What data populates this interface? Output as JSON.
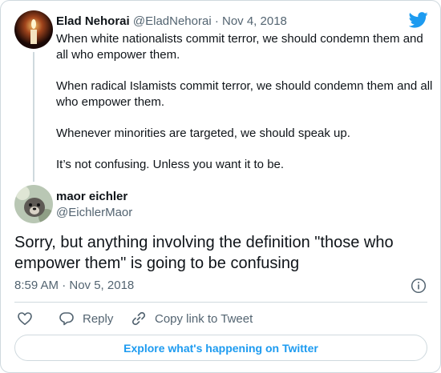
{
  "parent_tweet": {
    "display_name": "Elad Nehorai",
    "handle": "@EladNehorai",
    "separator": "·",
    "date": "Nov 4, 2018",
    "paragraphs": [
      "When white nationalists commit terror, we should condemn them and all who empower them.",
      "When radical Islamists commit terror, we should condemn them and all who empower them.",
      "Whenever minorities are targeted, we should speak up.",
      "It’s not confusing. Unless you want it to be."
    ]
  },
  "reply_tweet": {
    "display_name": "maor eichler",
    "handle": "@EichlerMaor",
    "text": "Sorry, but anything involving the definition \"those who empower them\" is going to be confusing",
    "timestamp": "8:59 AM · Nov 5, 2018"
  },
  "actions": {
    "reply_label": "Reply",
    "copy_label": "Copy link to Tweet"
  },
  "explore_button": {
    "label": "Explore what's happening on Twitter"
  },
  "icons": {
    "brand": "twitter-bird-icon",
    "info": "info-icon",
    "like": "heart-icon",
    "reply": "reply-bubble-icon",
    "copy": "link-icon"
  },
  "colors": {
    "accent": "#1d9bf0",
    "text": "#0f1419",
    "muted": "#536471",
    "border": "#cfd9de"
  }
}
